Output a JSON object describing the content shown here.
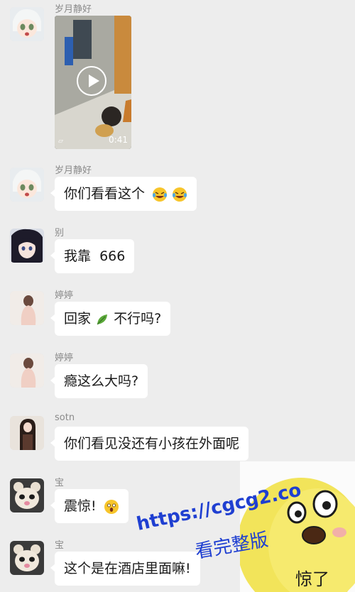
{
  "messages": [
    {
      "sender": "岁月静好",
      "type": "video",
      "duration": "0:41"
    },
    {
      "sender": "岁月静好",
      "text": "你们看看这个",
      "emoji": [
        "laugh-cry-emoji",
        "laugh-cry-emoji"
      ]
    },
    {
      "sender": "别",
      "text": "我靠  666"
    },
    {
      "sender": "婷婷",
      "text_before": "回家",
      "emoji": [
        "leaf-emoji"
      ],
      "text_after": "不行吗?"
    },
    {
      "sender": "婷婷",
      "text": "瘾这么大吗?"
    },
    {
      "sender": "sotn",
      "text": "你们看见没还有小孩在外面呢"
    },
    {
      "sender": "宝",
      "text": "震惊!",
      "emoji": [
        "shocked-emoji"
      ]
    },
    {
      "sender": "宝",
      "text": "这个是在酒店里面嘛!"
    }
  ],
  "sticker": {
    "caption": "惊了"
  },
  "watermark": {
    "line1": "https://cgcg2.co",
    "line2": "看完整版"
  },
  "colors": {
    "background": "#ededed",
    "bubble": "#ffffff",
    "watermark": "#1f3fd1"
  }
}
